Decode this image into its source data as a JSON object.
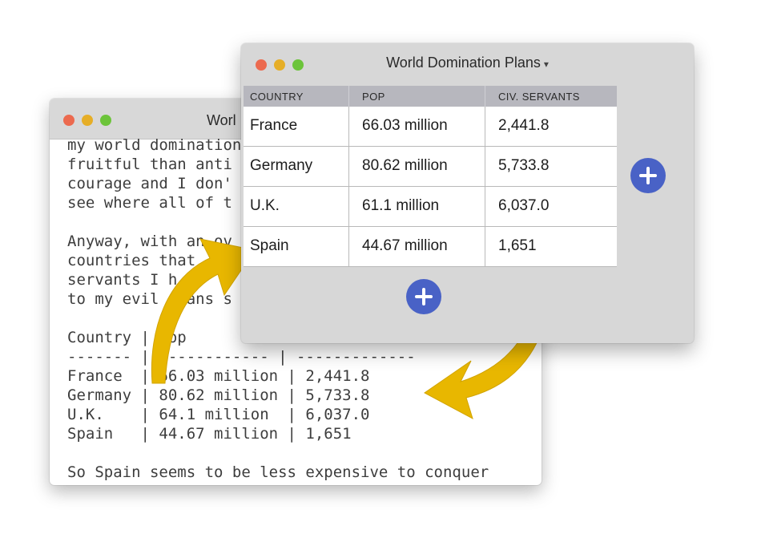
{
  "editor_window": {
    "title": "World Domination Plans",
    "visible_title": "Worl",
    "lines": [
      "my world domination",
      "fruitful than anti",
      "courage and I don'",
      "see where all of t",
      "",
      "Anyway, with an ov",
      "countries that",
      "servants I h",
      "to my evil plans s",
      "",
      "Country | Pop",
      "------- | ------------ | -------------",
      "France  | 66.03 million | 2,441.8",
      "Germany | 80.62 million | 5,733.8",
      "U.K.    | 64.1 million  | 6,037.0",
      "Spain   | 44.67 million | 1,651",
      "",
      "So Spain seems to be less expensive to conquer"
    ]
  },
  "table_window": {
    "title": "World Domination Plans",
    "title_chevron": "▾",
    "columns": [
      "COUNTRY",
      "POP",
      "CIV. SERVANTS"
    ],
    "rows": [
      [
        "France",
        "66.03 million",
        "2,441.8"
      ],
      [
        "Germany",
        "80.62 million",
        "5,733.8"
      ],
      [
        "U.K.",
        "61.1 million",
        "6,037.0"
      ],
      [
        "Spain",
        "44.67 million",
        "1,651"
      ]
    ],
    "add_column_icon": "plus-circle-icon",
    "add_row_icon": "plus-circle-icon"
  },
  "colors": {
    "arrow": "#e8b700",
    "accent_button": "#4962c6",
    "header_bg": "#b7b7be",
    "window_bg": "#d7d7d7"
  }
}
